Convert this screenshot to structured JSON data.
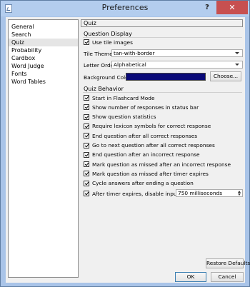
{
  "window": {
    "title": "Preferences",
    "help_label": "?",
    "close_label": "✕"
  },
  "nav": {
    "items": [
      {
        "label": "General",
        "selected": false
      },
      {
        "label": "Search",
        "selected": false
      },
      {
        "label": "Quiz",
        "selected": true
      },
      {
        "label": "Probability",
        "selected": false
      },
      {
        "label": "Cardbox",
        "selected": false
      },
      {
        "label": "Word Judge",
        "selected": false
      },
      {
        "label": "Fonts",
        "selected": false
      },
      {
        "label": "Word Tables",
        "selected": false
      }
    ]
  },
  "page": {
    "header": "Quiz"
  },
  "question_display": {
    "title": "Question Display",
    "use_tile_images": {
      "label": "Use tile images",
      "checked": true
    },
    "tile_theme": {
      "label": "Tile Theme:",
      "value": "tan-with-border"
    },
    "letter_order": {
      "label": "Letter Order:",
      "value": "Alphabetical"
    },
    "background_color": {
      "label": "Background Color:",
      "value": "#0a0a78",
      "choose_label": "Choose..."
    }
  },
  "quiz_behavior": {
    "title": "Quiz Behavior",
    "options": [
      {
        "label": "Start in Flashcard Mode",
        "checked": true
      },
      {
        "label": "Show number of responses in status bar",
        "checked": true
      },
      {
        "label": "Show question statistics",
        "checked": true
      },
      {
        "label": "Require lexicon symbols for correct response",
        "checked": true
      },
      {
        "label": "End question after all correct responses",
        "checked": true
      },
      {
        "label": "Go to next question after all correct responses",
        "checked": true
      },
      {
        "label": "End question after an incorrect response",
        "checked": true
      },
      {
        "label": "Mark question as missed after an incorrect response",
        "checked": true
      },
      {
        "label": "Mark question as missed after timer expires",
        "checked": true
      },
      {
        "label": "Cycle answers after ending a question",
        "checked": true
      }
    ],
    "disable_input": {
      "label": "After timer expires, disable input for:",
      "checked": true,
      "value": "750 milliseconds"
    }
  },
  "buttons": {
    "restore_defaults": "Restore Defaults",
    "ok": "OK",
    "cancel": "Cancel"
  }
}
